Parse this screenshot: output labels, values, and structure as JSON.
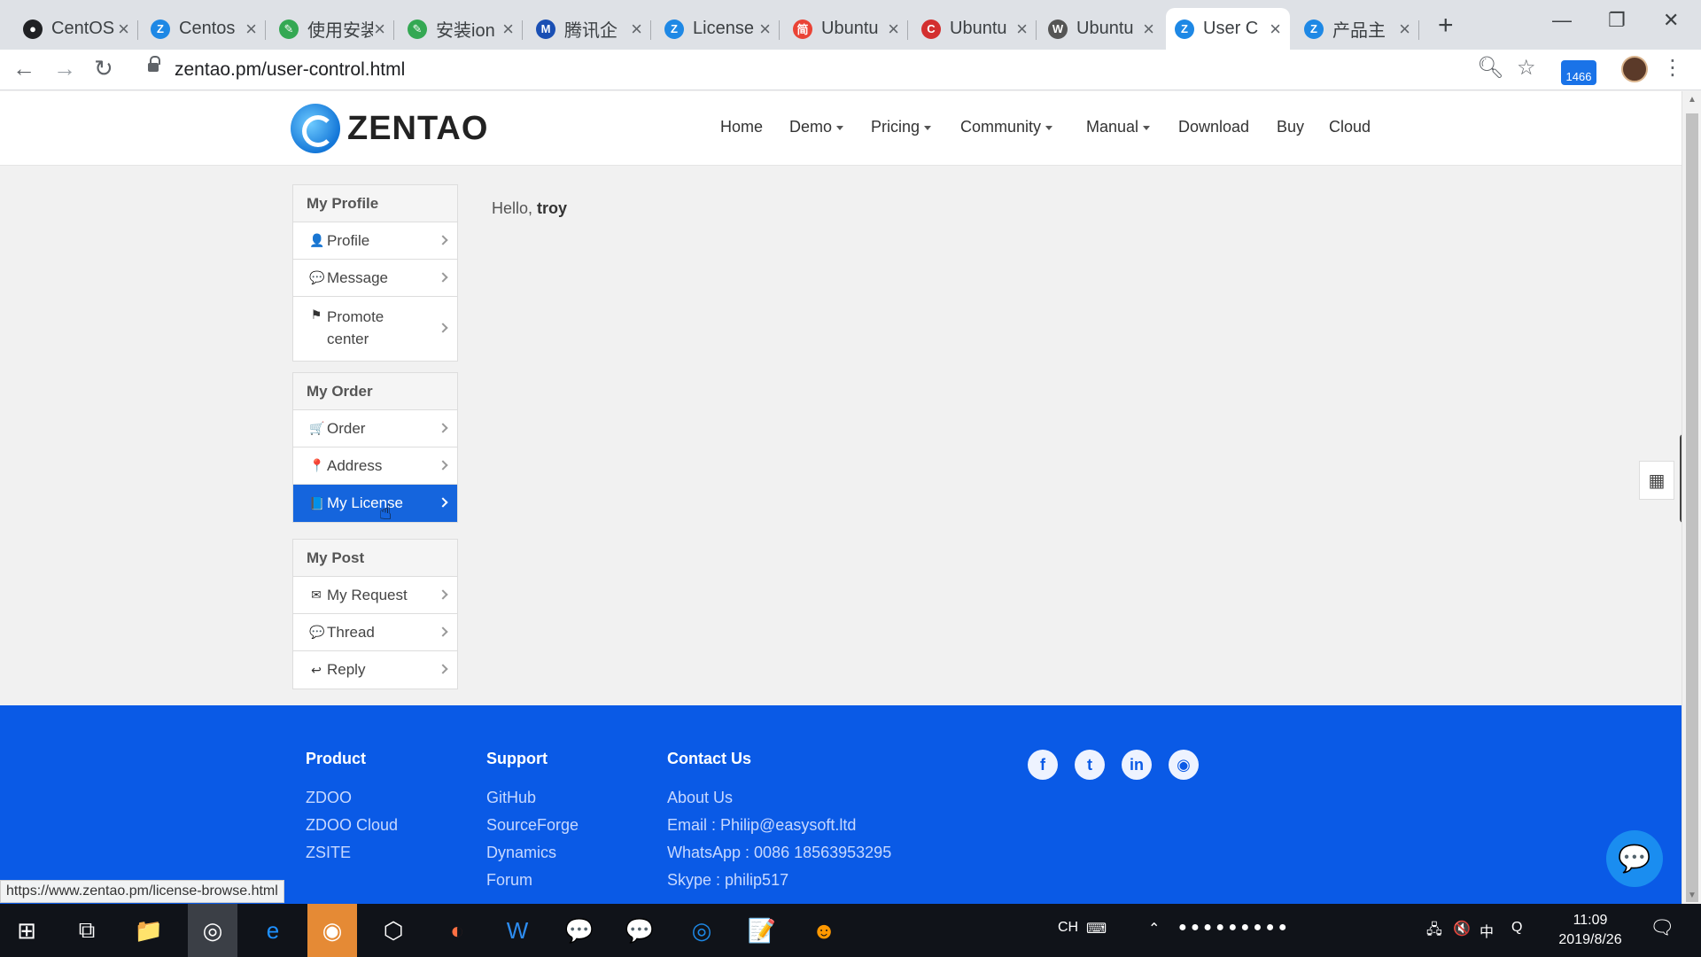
{
  "browser": {
    "tabs": [
      {
        "title": "CentOS",
        "fav": "●",
        "color": "#202124"
      },
      {
        "title": "Centos",
        "fav": "Z",
        "color": "#1e88e5"
      },
      {
        "title": "使用安装",
        "fav": "✎",
        "color": "#34a853"
      },
      {
        "title": "安装ion",
        "fav": "✎",
        "color": "#34a853"
      },
      {
        "title": "腾讯企",
        "fav": "M",
        "color": "#1a4fb4"
      },
      {
        "title": "License",
        "fav": "Z",
        "color": "#1e88e5"
      },
      {
        "title": "Ubuntu",
        "fav": "简",
        "color": "#ea4335"
      },
      {
        "title": "Ubuntu",
        "fav": "C",
        "color": "#d32f2f"
      },
      {
        "title": "Ubuntu",
        "fav": "W",
        "color": "#555555"
      },
      {
        "title": "User C",
        "fav": "Z",
        "color": "#1e88e5"
      },
      {
        "title": "产品主",
        "fav": "Z",
        "color": "#1e88e5"
      }
    ],
    "url": "zentao.pm/user-control.html",
    "extension_badge": "1466",
    "status_url": "https://www.zentao.pm/license-browse.html"
  },
  "site": {
    "logo_text": "ZENTAO",
    "nav": [
      {
        "label": "Home",
        "dropdown": false
      },
      {
        "label": "Demo",
        "dropdown": true
      },
      {
        "label": "Pricing",
        "dropdown": true
      },
      {
        "label": "Community",
        "dropdown": true
      },
      {
        "label": "Manual",
        "dropdown": true
      },
      {
        "label": "Download",
        "dropdown": false
      },
      {
        "label": "Buy",
        "dropdown": false
      },
      {
        "label": "Cloud",
        "dropdown": false
      }
    ]
  },
  "sidebar": {
    "groups": [
      {
        "title": "My Profile",
        "items": [
          {
            "label": "Profile",
            "icon": "user-icon",
            "glyph": "👤"
          },
          {
            "label": "Message",
            "icon": "comments-icon",
            "glyph": "💬"
          },
          {
            "label": "Promote center",
            "icon": "flag-icon",
            "glyph": "⚑"
          }
        ]
      },
      {
        "title": "My Order",
        "items": [
          {
            "label": "Order",
            "icon": "cart-icon",
            "glyph": "🛒"
          },
          {
            "label": "Address",
            "icon": "map-marker-icon",
            "glyph": "📍"
          },
          {
            "label": "My License",
            "icon": "book-icon",
            "glyph": "📘",
            "active": true
          }
        ]
      },
      {
        "title": "My Post",
        "items": [
          {
            "label": "My Request",
            "icon": "envelope-icon",
            "glyph": "✉"
          },
          {
            "label": "Thread",
            "icon": "comment-icon",
            "glyph": "💬"
          },
          {
            "label": "Reply",
            "icon": "reply-icon",
            "glyph": "↩"
          }
        ]
      }
    ]
  },
  "main": {
    "greeting": "Hello,",
    "username": "troy"
  },
  "footer": {
    "columns": [
      {
        "title": "Product",
        "links": [
          "ZDOO",
          "ZDOO Cloud",
          "ZSITE"
        ]
      },
      {
        "title": "Support",
        "links": [
          "GitHub",
          "SourceForge",
          "Dynamics",
          "Forum"
        ]
      },
      {
        "title": "Contact Us",
        "links": [
          "About Us",
          "Email : Philip@easysoft.ltd",
          "WhatsApp : 0086 18563953295",
          "Skype : philip517"
        ]
      }
    ],
    "social": [
      {
        "name": "facebook-icon",
        "glyph": "f"
      },
      {
        "name": "twitter-icon",
        "glyph": "t"
      },
      {
        "name": "linkedin-icon",
        "glyph": "in"
      },
      {
        "name": "github-icon",
        "glyph": "◉"
      }
    ]
  },
  "taskbar": {
    "time": "11:09",
    "date": "2019/8/26",
    "lang": "CH",
    "ime": "中"
  },
  "colors": {
    "accent": "#1565dd",
    "footer": "#0a5ae6"
  }
}
